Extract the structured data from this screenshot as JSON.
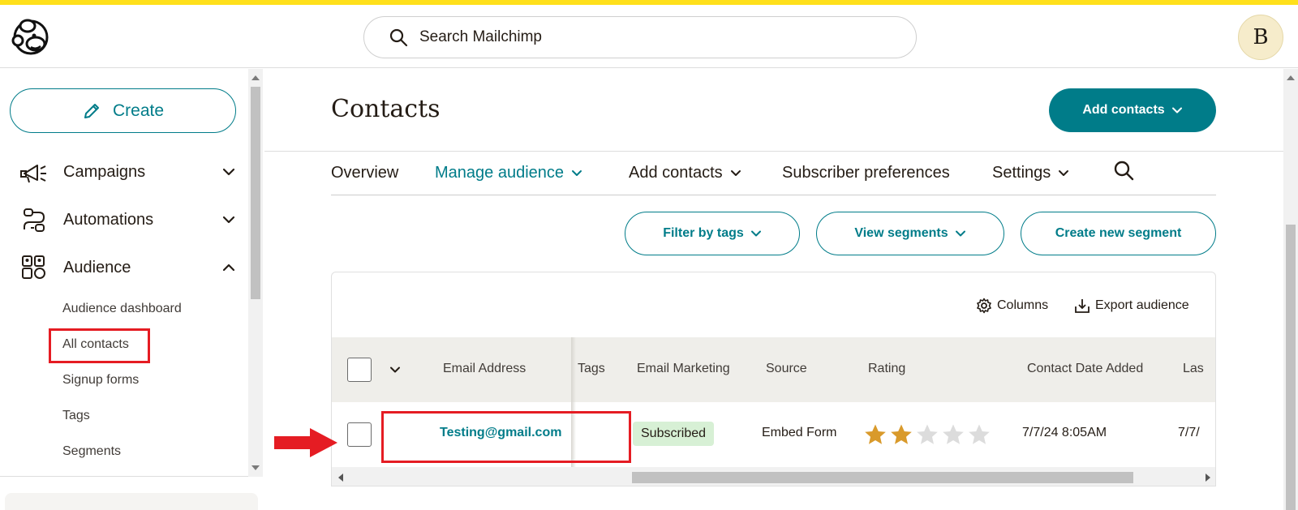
{
  "topbar": {
    "search_placeholder": "Search Mailchimp",
    "avatar_initial": "B"
  },
  "sidebar": {
    "create_label": "Create",
    "nav": [
      {
        "label": "Campaigns",
        "icon": "megaphone-icon",
        "expanded": false
      },
      {
        "label": "Automations",
        "icon": "automation-flow-icon",
        "expanded": false
      },
      {
        "label": "Audience",
        "icon": "audience-icon",
        "expanded": true
      }
    ],
    "audience_items": [
      "Audience dashboard",
      "All contacts",
      "Signup forms",
      "Tags",
      "Segments"
    ],
    "selected_item": "All contacts"
  },
  "main": {
    "title": "Contacts",
    "add_contacts_label": "Add contacts",
    "tabs": [
      {
        "label": "Overview",
        "active": false,
        "dropdown": false
      },
      {
        "label": "Manage audience",
        "active": true,
        "dropdown": true
      },
      {
        "label": "Add contacts",
        "active": false,
        "dropdown": true
      },
      {
        "label": "Subscriber preferences",
        "active": false,
        "dropdown": false
      },
      {
        "label": "Settings",
        "active": false,
        "dropdown": true
      }
    ],
    "filters": {
      "filter_by_tags": "Filter by tags",
      "view_segments": "View segments",
      "create_new_segment": "Create new segment"
    },
    "toolbar": {
      "columns_label": "Columns",
      "export_label": "Export audience"
    },
    "table": {
      "headers": [
        "Email Address",
        "Tags",
        "Email Marketing",
        "Source",
        "Rating",
        "Contact Date Added",
        "Las"
      ],
      "rows": [
        {
          "email": "Testing@gmail.com",
          "tags": "",
          "email_marketing": "Subscribed",
          "source": "Embed Form",
          "rating": 2,
          "rating_max": 5,
          "date_added": "7/7/24 8:05AM",
          "last": "7/7/"
        }
      ]
    }
  },
  "colors": {
    "brand_teal": "#007c89",
    "highlight_red": "#e51c23",
    "star_filled": "#d99a2b",
    "star_empty": "#dcdcdc",
    "top_stripe": "#ffe01b"
  }
}
